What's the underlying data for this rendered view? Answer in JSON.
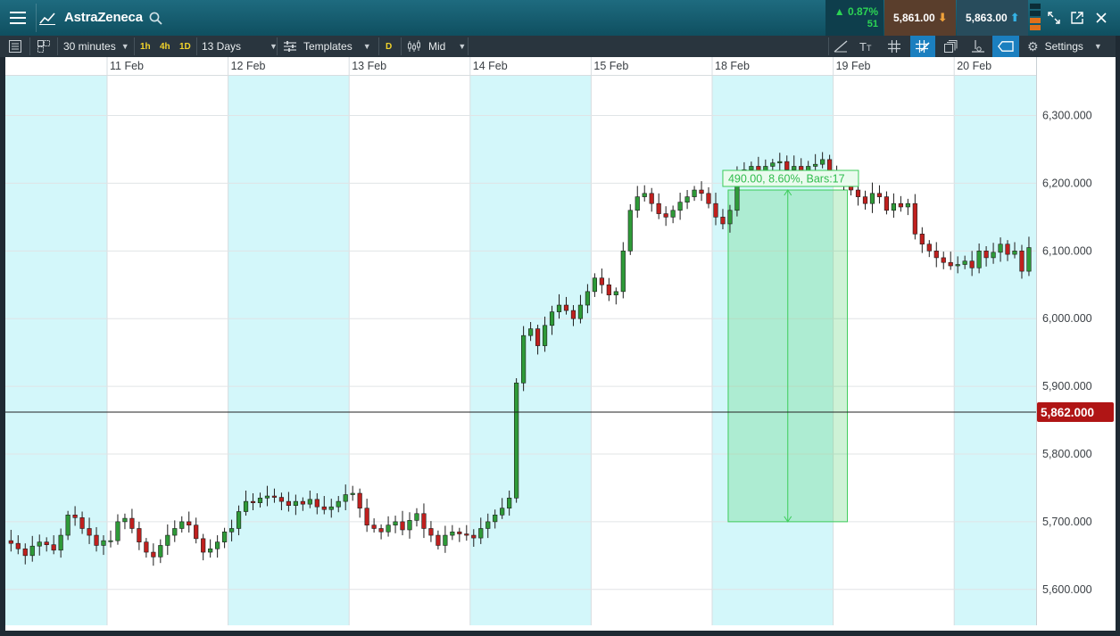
{
  "window": {
    "title": "AstraZeneca",
    "change_pct": "▲ 0.87%",
    "change_pts": "51",
    "sell_price": "5,861.00",
    "buy_price": "5,863.00"
  },
  "toolbar": {
    "interval": "30 minutes",
    "tf_1h": "1h",
    "tf_4h": "4h",
    "tf_1d": "1D",
    "range": "13 Days",
    "templates": "Templates",
    "d_badge": "D",
    "price_mode": "Mid",
    "settings": "Settings"
  },
  "icons": [
    "menu-icon",
    "chart-line-icon",
    "search-icon",
    "expand-icon",
    "popout-icon",
    "close-icon",
    "list-icon",
    "layout-icon",
    "templates-icon",
    "candles-icon",
    "draw-line-icon",
    "text-icon",
    "grid-icon",
    "crosshair-icon",
    "layers-icon",
    "marker-icon",
    "tag-icon",
    "gear-icon"
  ],
  "colors": {
    "up": "#2e9a38",
    "down": "#c0201e",
    "accent": "#1b7fbf",
    "measure": "#3ccc5a",
    "price_label": "#b01515"
  },
  "chart_data": {
    "type": "candlestick",
    "x_labels": [
      "11 Feb",
      "12 Feb",
      "13 Feb",
      "14 Feb",
      "15 Feb",
      "18 Feb",
      "19 Feb",
      "20 Feb"
    ],
    "y_ticks": [
      "5,600.000",
      "5,700.000",
      "5,800.000",
      "5,900.000",
      "6,000.000",
      "6,100.000",
      "6,200.000",
      "6,300.000"
    ],
    "y_tick_values": [
      5600,
      5700,
      5800,
      5900,
      6000,
      6100,
      6200,
      6300
    ],
    "ylim": [
      5547,
      6360
    ],
    "current_price": 5862,
    "current_price_label": "5,862.000",
    "shaded_days": [
      0,
      2,
      4,
      6,
      8
    ],
    "measure": {
      "label": "490.00, 8.60%, Bars:17",
      "low": 5700,
      "high": 6190,
      "from_bar": 104,
      "to_bar": 121
    },
    "bars_per_day": 17,
    "closes": [
      5660,
      5655,
      5672,
      5668,
      5660,
      5650,
      5664,
      5670,
      5666,
      5658,
      5680,
      5710,
      5706,
      5690,
      5680,
      5665,
      5672,
      5672,
      5700,
      5705,
      5690,
      5670,
      5655,
      5648,
      5665,
      5680,
      5690,
      5700,
      5695,
      5675,
      5655,
      5660,
      5670,
      5685,
      5690,
      5715,
      5730,
      5728,
      5735,
      5738,
      5736,
      5730,
      5724,
      5730,
      5726,
      5733,
      5722,
      5718,
      5722,
      5730,
      5740,
      5742,
      5720,
      5695,
      5690,
      5685,
      5695,
      5700,
      5688,
      5702,
      5712,
      5690,
      5680,
      5665,
      5680,
      5685,
      5682,
      5680,
      5676,
      5690,
      5700,
      5710,
      5720,
      5735,
      5905,
      5975,
      5985,
      5960,
      5990,
      6010,
      6020,
      6012,
      6000,
      6020,
      6040,
      6060,
      6050,
      6035,
      6040,
      6100,
      6160,
      6180,
      6185,
      6170,
      6155,
      6150,
      6160,
      6172,
      6180,
      6190,
      6185,
      6170,
      6150,
      6140,
      6160,
      6210,
      6220,
      6225,
      6218,
      6225,
      6230,
      6232,
      6220,
      6225,
      6215,
      6225,
      6228,
      6235,
      6212,
      6205,
      6202,
      6190,
      6180,
      6170,
      6185,
      6180,
      6160,
      6170,
      6165,
      6170,
      6125,
      6110,
      6100,
      6090,
      6083,
      6078,
      6080,
      6085,
      6075,
      6100,
      6090,
      6098,
      6110,
      6095,
      6100,
      6070,
      6105,
      6095,
      6090,
      6082,
      6085,
      6088,
      6092
    ]
  }
}
